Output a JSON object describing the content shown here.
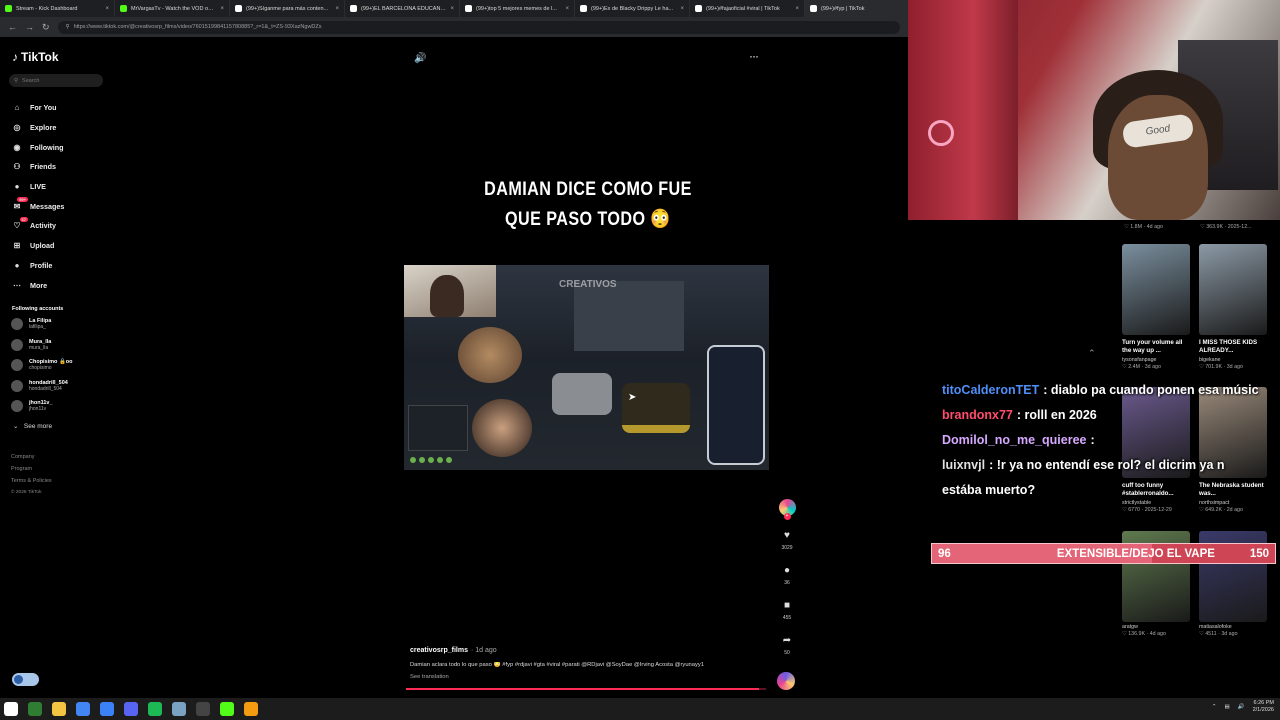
{
  "browser": {
    "tabs": [
      {
        "label": "Stream - Kick Dashboard",
        "color": "#53fc18",
        "active": false
      },
      {
        "label": "MrVargasTv - Watch the VOD on ...",
        "color": "#53fc18",
        "active": false
      },
      {
        "label": "(99+)Síganme para más conten...",
        "color": "#ffffff",
        "active": false
      },
      {
        "label": "(99+)EL BARCELONA EDUCANI...",
        "color": "#ffffff",
        "active": false
      },
      {
        "label": "(99+)top 5 mejores memes de l...",
        "color": "#ffffff",
        "active": false
      },
      {
        "label": "(99+)Ex de Blacky Drippy Le ha...",
        "color": "#ffffff",
        "active": false
      },
      {
        "label": "(99+)#fajaoficial #viral | TikTok",
        "color": "#ffffff",
        "active": false
      },
      {
        "label": "(99+)#fyp | TikTok",
        "color": "#ffffff",
        "active": true
      }
    ],
    "url": "https://www.tiktok.com/@creativosrp_films/video/7601519984115780885?_r=1&_t=ZS-93XazNgwDZs"
  },
  "sidebar": {
    "logo": "TikTok",
    "search_placeholder": "Search",
    "menu": [
      {
        "label": "For You",
        "icon": "home-icon",
        "glyph": "⌂"
      },
      {
        "label": "Explore",
        "icon": "compass-icon",
        "glyph": "◎"
      },
      {
        "label": "Following",
        "icon": "following-icon",
        "glyph": "◉"
      },
      {
        "label": "Friends",
        "icon": "friends-icon",
        "glyph": "⚇"
      },
      {
        "label": "LIVE",
        "icon": "live-icon",
        "glyph": "●"
      },
      {
        "label": "Messages",
        "icon": "messages-icon",
        "glyph": "✉",
        "badge": "99+"
      },
      {
        "label": "Activity",
        "icon": "activity-icon",
        "glyph": "♡",
        "badge": "67"
      },
      {
        "label": "Upload",
        "icon": "upload-icon",
        "glyph": "⊞"
      },
      {
        "label": "Profile",
        "icon": "profile-icon",
        "glyph": "●"
      },
      {
        "label": "More",
        "icon": "more-icon",
        "glyph": "⋯"
      }
    ],
    "following_header": "Following accounts",
    "accounts": [
      {
        "name": "La Filipa",
        "handle": "lafilipa_"
      },
      {
        "name": "Mura_lla",
        "handle": "mura_lla"
      },
      {
        "name": "Chopisimo 🔒oo",
        "handle": "chopisimo"
      },
      {
        "name": "hondadrill_504",
        "handle": "hondadrill_504"
      },
      {
        "name": "jhon11v_",
        "handle": "jhon11v"
      }
    ],
    "see_more": "See more",
    "footer": [
      "Company",
      "Program",
      "Terms & Policies"
    ],
    "copyright": "© 2026 TikTok"
  },
  "video": {
    "caption_line1": "DAMIAN DICE COMO FUE",
    "caption_line2": "QUE PASO TODO 😳",
    "watermark": "CREATIVOS",
    "author": "creativosrp_films",
    "time": "· 1d ago",
    "description": "Damian aclara todo lo que paso 😳 #fyp #rdjavi #gta #viral #parati @RDjavi @SoyDae @Irving Acosta @ryunayy1",
    "see_translation": "See translation",
    "progress": 0.98,
    "actions": [
      {
        "icon": "heart-icon",
        "glyph": "♥",
        "count": "3029"
      },
      {
        "icon": "comment-icon",
        "glyph": "●",
        "count": "36"
      },
      {
        "icon": "bookmark-icon",
        "glyph": "■",
        "count": "455"
      },
      {
        "icon": "share-icon",
        "glyph": "➦",
        "count": "50"
      }
    ]
  },
  "recommended": {
    "top_row": [
      {
        "meta": "♡ 1.8M · 4d ago"
      },
      {
        "meta": "♡ 363.9K · 2025-12..."
      }
    ],
    "items": [
      {
        "title": "Turn your volume all the way up ...",
        "author": "tysonsfanpage",
        "meta": "♡ 2.4M · 3d ago",
        "thumb": "#7a8f9e"
      },
      {
        "title": "I MISS THOSE KIDS ALREADY...",
        "author": "bigekane",
        "meta": "♡ 701.9K · 3d ago",
        "thumb": "#8c9aa6"
      },
      {
        "title": "cuff too funny #stablerronaldo...",
        "author": "strictlystable",
        "meta": "♡ 6770 · 2025-12-29",
        "thumb": "#6b5a8e"
      },
      {
        "title": "The Nebraska student was...",
        "author": "northsimpact",
        "meta": "♡ 649.2K · 2d ago",
        "thumb": "#9a8a7a"
      },
      {
        "title": "",
        "author": "aratgw",
        "meta": "♡ 136.9K · 4d ago",
        "thumb": "#5f7a4e"
      },
      {
        "title": "",
        "author": "matiasalofoke",
        "meta": "♡ 4511 · 3d ago",
        "thumb": "#3a3a6a"
      }
    ]
  },
  "chat": [
    {
      "user": "titoCalderonTET",
      "user_color": "#4f8ff7",
      "msg": ": diablo pa cuando ponen esa músic"
    },
    {
      "user": "brandonx77",
      "user_color": "#ff4d6d",
      "msg": ": rolll en 2026"
    },
    {
      "user": "Domilol_no_me_quieree",
      "user_color": "#d6a8ff",
      "msg": ": "
    },
    {
      "user": "luixnvjl",
      "user_color": "#e0e0e0",
      "msg": ": !r ya no entendí ese rol? el dicrim ya n"
    },
    {
      "user": "",
      "user_color": "#ffffff",
      "msg": "estába muerto?"
    }
  ],
  "goal": {
    "current": "96",
    "label": "EXTENSIBLE/DEJO EL VAPE",
    "target": "150",
    "fraction": 0.64
  },
  "webcam": {
    "band_text": "Good"
  },
  "taskbar": {
    "icons": [
      {
        "name": "start-icon",
        "color": "#ffffff"
      },
      {
        "name": "terminal-icon",
        "color": "#2e7d32"
      },
      {
        "name": "folder-icon",
        "color": "#f4c542"
      },
      {
        "name": "chrome-icon",
        "color": "#4285f4"
      },
      {
        "name": "app-icon",
        "color": "#3b82f6"
      },
      {
        "name": "discord-icon",
        "color": "#5865f2"
      },
      {
        "name": "spotify-icon",
        "color": "#1db954"
      },
      {
        "name": "app-icon-2",
        "color": "#7aa2c2"
      },
      {
        "name": "obs-icon",
        "color": "#444444"
      },
      {
        "name": "kick-icon",
        "color": "#53fc18"
      },
      {
        "name": "app-icon-3",
        "color": "#f39c12"
      }
    ],
    "time": "6:26 PM",
    "date": "2/1/2026"
  }
}
